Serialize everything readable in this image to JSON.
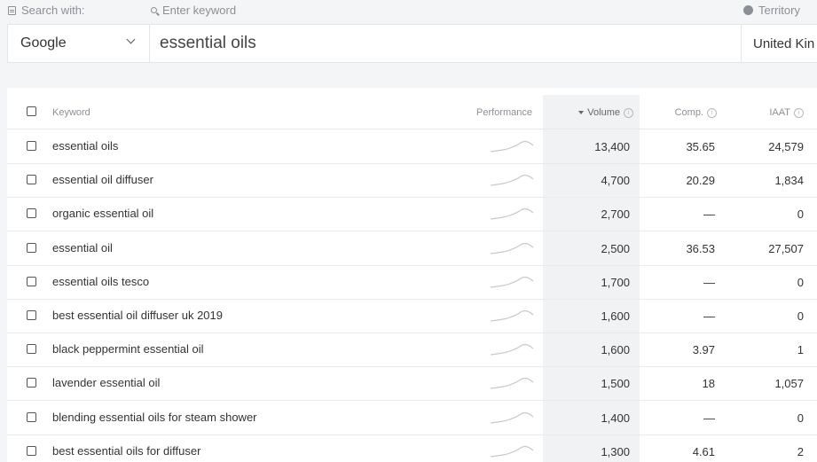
{
  "labels": {
    "search_with": "Search with:",
    "enter_keyword": "Enter keyword",
    "territory": "Territory"
  },
  "search": {
    "engine": "Google",
    "keyword": "essential oils",
    "territory_value": "United Kin"
  },
  "table": {
    "headers": {
      "keyword": "Keyword",
      "performance": "Performance",
      "volume": "Volume",
      "comp": "Comp.",
      "iaat": "IAAT"
    },
    "rows": [
      {
        "keyword": "essential oils",
        "volume": "13,400",
        "comp": "35.65",
        "iaat": "24,579"
      },
      {
        "keyword": "essential oil diffuser",
        "volume": "4,700",
        "comp": "20.29",
        "iaat": "1,834"
      },
      {
        "keyword": "organic essential oil",
        "volume": "2,700",
        "comp": "—",
        "iaat": "0"
      },
      {
        "keyword": "essential oil",
        "volume": "2,500",
        "comp": "36.53",
        "iaat": "27,507"
      },
      {
        "keyword": "essential oils tesco",
        "volume": "1,700",
        "comp": "—",
        "iaat": "0"
      },
      {
        "keyword": "best essential oil diffuser uk 2019",
        "volume": "1,600",
        "comp": "—",
        "iaat": "0"
      },
      {
        "keyword": "black peppermint essential oil",
        "volume": "1,600",
        "comp": "3.97",
        "iaat": "1"
      },
      {
        "keyword": "lavender essential oil",
        "volume": "1,500",
        "comp": "18",
        "iaat": "1,057"
      },
      {
        "keyword": "blending essential oils for steam shower",
        "volume": "1,400",
        "comp": "—",
        "iaat": "0"
      },
      {
        "keyword": "best essential oils for diffuser",
        "volume": "1,300",
        "comp": "4.61",
        "iaat": "2"
      }
    ]
  },
  "colors": {
    "accent_line": "#c5cad1",
    "volume_column_bg": "#f1f2f4"
  }
}
